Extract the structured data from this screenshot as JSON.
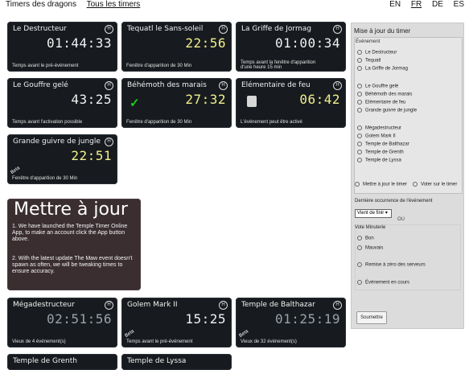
{
  "nav": {
    "timers": "Timers des dragons",
    "all": "Tous les timers"
  },
  "langs": [
    "EN",
    "FR",
    "DE",
    "ES"
  ],
  "cards": [
    {
      "title": "Le Destructeur",
      "time": "01:44:33",
      "sub": "Temps avant le pré-événement"
    },
    {
      "title": "Tequatl le Sans-soleil",
      "time": "22:56",
      "sub": "Fenêtre d'apparition de 30 Min"
    },
    {
      "title": "La Griffe de Jormag",
      "time": "01:00:34",
      "sub": "Temps avant la fenêtre d'apparition\nd'une heure 15 min"
    },
    {
      "title": "Le Gouffre gelé",
      "time": "43:25",
      "sub": "Temps avant l'activation possible"
    },
    {
      "title": "Béhémoth des marais",
      "time": "27:32",
      "sub": "Fenêtre d'apparition de 30 Min"
    },
    {
      "title": "Elémentaire de feu",
      "time": "06:42",
      "sub": "L'événement peut être activé"
    },
    {
      "title": "Grande guivre de jungle",
      "time": "22:51",
      "sub": "Fenêtre d'apparition de 30 Min",
      "beta": "Beta"
    },
    {
      "title": "Mégadestructeur",
      "time": "02:51:56",
      "sub": "Vieux de 4 événement(s)"
    },
    {
      "title": "Golem Mark II",
      "time": "15:25",
      "sub": "Temps avant le pré-événement",
      "beta": "Beta"
    },
    {
      "title": "Temple de Balthazar",
      "time": "01:25:19",
      "sub": "Vieux de 32 événement(s)",
      "beta": "Beta"
    },
    {
      "title": "Temple de Grenth",
      "time": "",
      "sub": ""
    },
    {
      "title": "Temple de Lyssa",
      "time": "",
      "sub": ""
    }
  ],
  "update": {
    "heading": "Mettre à jour",
    "p1": "1. We have launched the Temple Timer Online App, to make an account click the App button above.",
    "p2": "2. With the latest update The Maw event doesn't spawn as often, we will be tweaking times to ensure accuracy."
  },
  "sidebar": {
    "heading": "Mise à jour du timer",
    "legend": "Événement",
    "radios": [
      "Le Destructeur",
      "Tequatl",
      "La Griffe de Jormag",
      "Le Gouffre gelé",
      "Béhémoth des marais",
      "Elémentaire de feu",
      "Grande guivre de jungle",
      "Mégadestructeur",
      "Golem Mark II",
      "Temple de Balthazar",
      "Temple de Grenth",
      "Temple de Lyssa"
    ],
    "mode_update": "Mettre à jour le timer",
    "mode_vote": "Voter sur le timer",
    "last_label": "Dernière occurrence de l'événement",
    "select": "Vient de finir",
    "or": "OU",
    "vote_label": "Vote Minuterie",
    "good": "Bon",
    "bad": "Mauvais",
    "reset": "Remise à zéro des serveurs",
    "ongoing": "Événement en cours",
    "submit": "Soumettre"
  }
}
